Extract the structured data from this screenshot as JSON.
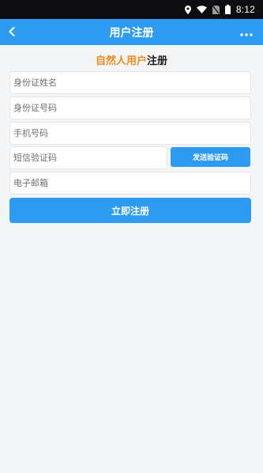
{
  "status_bar": {
    "time": "8:12",
    "icons": [
      "location-icon",
      "wifi-icon",
      "no-sim-icon",
      "battery-icon"
    ]
  },
  "app_bar": {
    "title": "用户注册",
    "back_icon": "chevron-left-icon",
    "more_icon": "more-horizontal-icon"
  },
  "heading": {
    "accent": "自然人用户",
    "plain": "注册"
  },
  "form": {
    "name_placeholder": "身份证姓名",
    "id_placeholder": "身份证号码",
    "phone_placeholder": "手机号码",
    "code_placeholder": "短信验证码",
    "send_code_label": "发送验证码",
    "email_placeholder": "电子邮箱",
    "submit_label": "立即注册"
  },
  "colors": {
    "primary": "#2d9cf0",
    "accent": "#f08a1c",
    "background": "#f4f5f7",
    "status_bar": "#0e0e10"
  }
}
